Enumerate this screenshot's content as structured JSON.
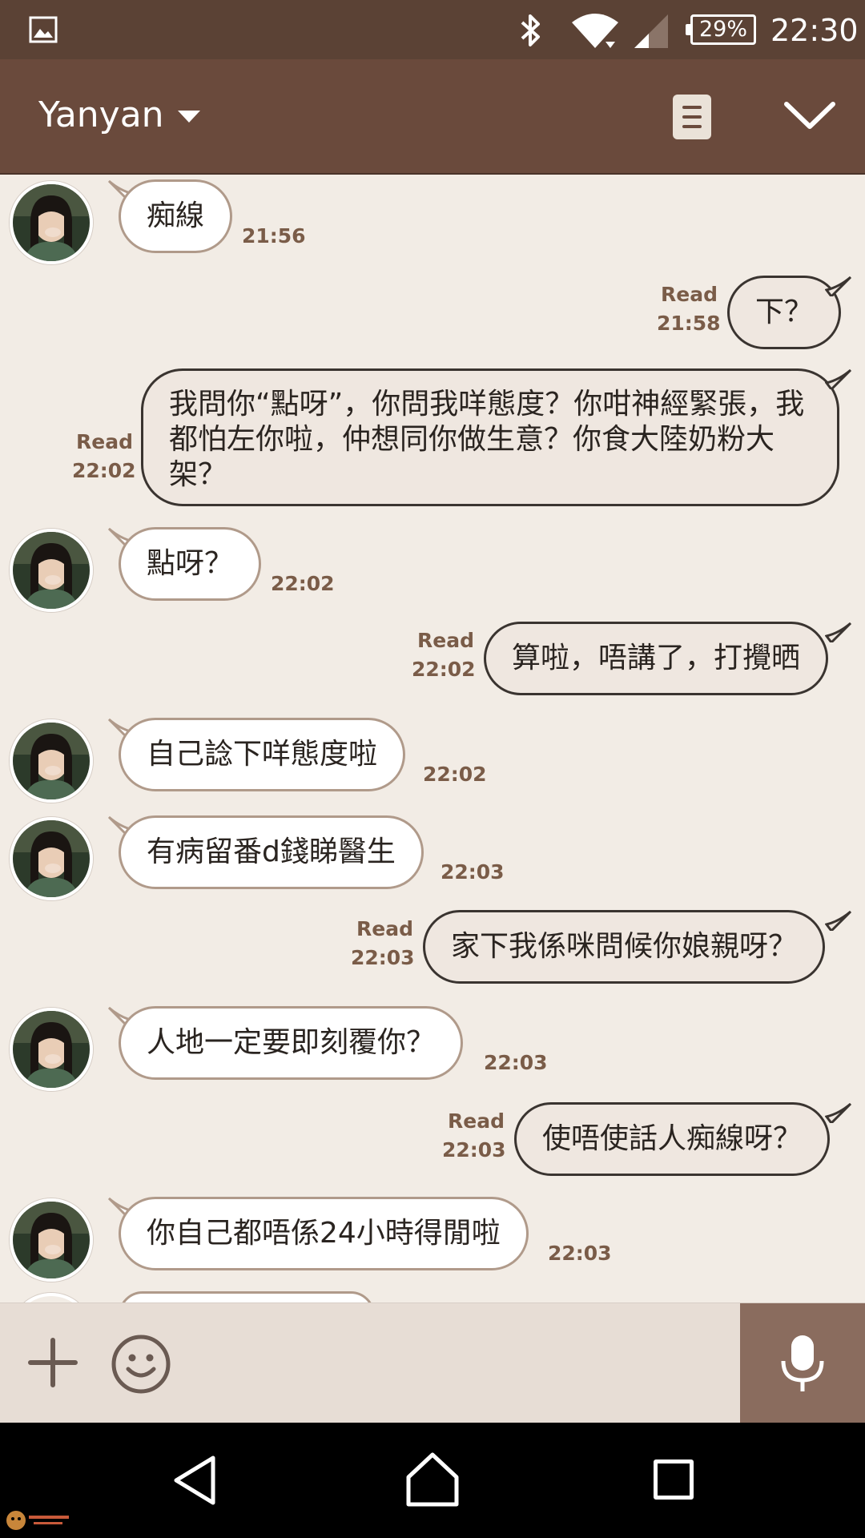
{
  "status_bar": {
    "battery": "29%",
    "clock": "22:30"
  },
  "header": {
    "contact_name": "Yanyan"
  },
  "messages": [
    {
      "side": "in",
      "text": "痴線",
      "time": "21:56"
    },
    {
      "side": "out",
      "read": "Read",
      "text": "下？",
      "time": "21:58"
    },
    {
      "side": "out",
      "read": "Read",
      "text": "我問你“點呀”，你問我咩態度？你咁神經緊張，我都怕左你啦，仲想同你做生意？你食大陸奶粉大架？",
      "time": "22:02"
    },
    {
      "side": "in",
      "text": "點呀？",
      "time": "22:02"
    },
    {
      "side": "out",
      "read": "Read",
      "text": "算啦，唔講了，打攪晒",
      "time": "22:02"
    },
    {
      "side": "in",
      "text": "自己諗下咩態度啦",
      "time": "22:02"
    },
    {
      "side": "in",
      "text": "有病留番d錢睇醫生",
      "time": "22:03"
    },
    {
      "side": "out",
      "read": "Read",
      "text": "家下我係咪問候你娘親呀？",
      "time": "22:03"
    },
    {
      "side": "in",
      "text": "人地一定要即刻覆你？",
      "time": "22:03"
    },
    {
      "side": "out",
      "read": "Read",
      "text": "使唔使話人痴線呀？",
      "time": "22:03"
    },
    {
      "side": "in",
      "text": "你自己都唔係24小時得閒啦",
      "time": "22:03"
    }
  ],
  "colors": {
    "statusbar": "#5b4235",
    "header": "#6a4a3c",
    "chat_background": "#f2ece5",
    "meta_text": "#7a5c48",
    "mic_button": "#8a6c5e"
  },
  "icons": {
    "status": [
      "gallery-icon",
      "bluetooth-icon",
      "wifi-icon",
      "signal-icon",
      "battery-icon"
    ],
    "header": [
      "dropdown-caret-icon",
      "notes-icon",
      "chevron-down-icon"
    ],
    "input": [
      "plus-icon",
      "emoji-icon",
      "microphone-icon"
    ],
    "nav": [
      "back-icon",
      "home-icon",
      "recent-apps-icon"
    ]
  }
}
